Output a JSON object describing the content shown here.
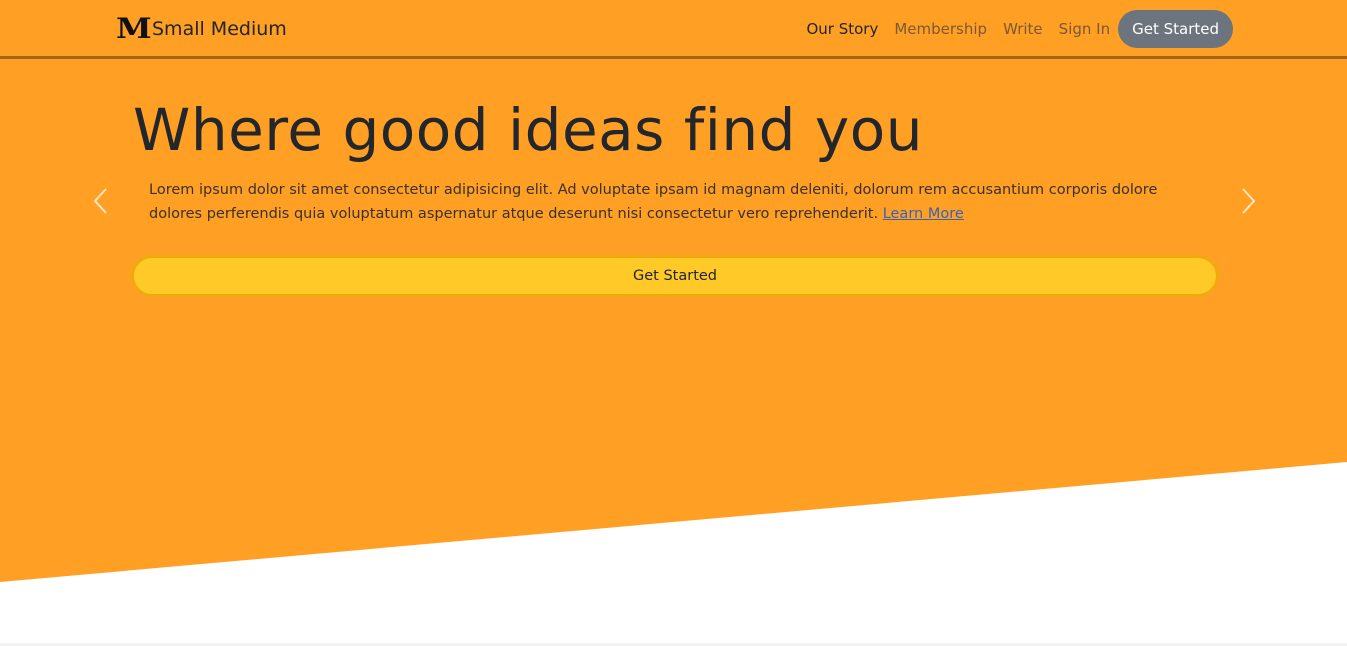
{
  "navbar": {
    "brand_logo": "M",
    "brand_name": "Small Medium",
    "links": [
      "Our Story",
      "Membership",
      "Write",
      "Sign In"
    ],
    "cta_label": "Get Started"
  },
  "hero": {
    "headline": "Where good ideas find you",
    "lead_text": "Lorem ipsum dolor sit amet consectetur adipisicing elit. Ad voluptate ipsam id magnam deleniti, dolorum rem accusantium corporis dolore dolores perferendis quia voluptatum aspernatur atque deserunt nisi consectetur vero reprehenderit.",
    "learn_more": "Learn More",
    "button_label": "Get Started"
  },
  "carousel": {
    "prev_icon": "chevron-left-icon",
    "next_icon": "chevron-right-icon"
  },
  "colors": {
    "hero_background": "#ff9f24",
    "cta_button": "#ffc927",
    "nav_button": "#6c757d",
    "link": "#3b63b4"
  }
}
